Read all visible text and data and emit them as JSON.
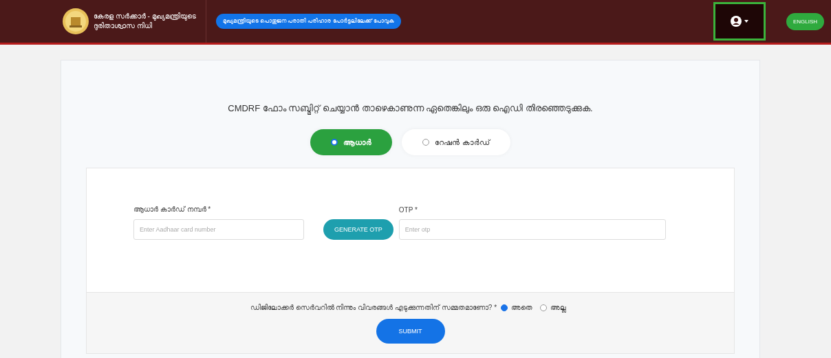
{
  "header": {
    "title_line1": "കേരള സർക്കാർ - മുഖ്യമന്ത്രിയുടെ",
    "title_line2": "ദുരിതാശ്വാസ നിധി",
    "portal_link": "മുഖ്യമന്ത്രിയുടെ പൊതുജന പരാതി പരിഹാര പോർട്ടലിലേക്ക് പോവുക",
    "language_button": "ENGLISH",
    "account_menu": {
      "highlighted": true
    }
  },
  "instruction": "CMDRF ഫോം സബ്മിറ്റ് ചെയ്യാൻ താഴെകാണുന്ന ഏതെങ്കിലും ഒരു ഐഡി തിരഞ്ഞെടുക്കുക.",
  "id_types": [
    {
      "label": "ആധാർ",
      "selected": true
    },
    {
      "label": "റേഷൻ കാർഡ്",
      "selected": false
    }
  ],
  "form": {
    "aadhaar": {
      "label": "ആധാർ കാർഡ് നമ്പർ *",
      "placeholder": "Enter Aadhaar card number"
    },
    "generate_button": "GENERATE OTP",
    "otp": {
      "label": "OTP *",
      "placeholder": "Enter otp"
    }
  },
  "consent": {
    "question": "ഡിജിലോക്കർ സെർവറിൽ നിന്നും വിവരങ്ങൾ എടുക്കുന്നതിന് സമ്മതമാണോ? *",
    "options": [
      {
        "label": "അതെ",
        "selected": true
      },
      {
        "label": "അല്ല",
        "selected": false
      }
    ]
  },
  "submit_button": "SUBMIT"
}
